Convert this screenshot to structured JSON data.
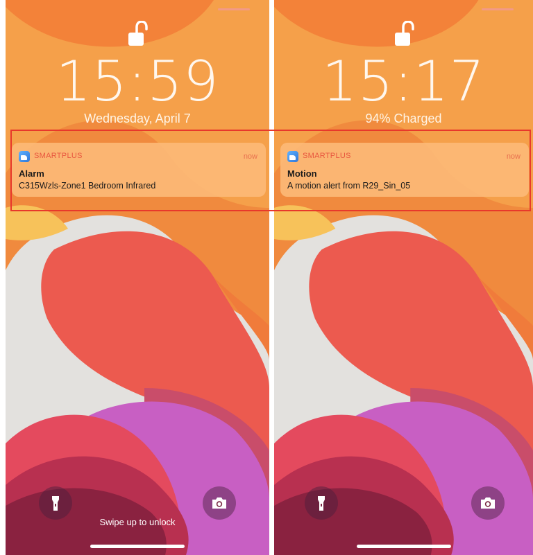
{
  "screens": [
    {
      "time": "15:59",
      "subline": "Wednesday, April 7",
      "notification": {
        "app_name": "SMARTPLUS",
        "timestamp": "now",
        "title": "Alarm",
        "body": "C315Wzls-Zone1 Bedroom Infrared"
      },
      "unlock_hint": "Swipe up to unlock"
    },
    {
      "time": "15:17",
      "subline": "94% Charged",
      "notification": {
        "app_name": "SMARTPLUS",
        "timestamp": "now",
        "title": "Motion",
        "body": "A motion alert from R29_Sin_05"
      }
    }
  ],
  "icons": {
    "lock": "unlocked-padlock-icon",
    "flashlight": "flashlight-icon",
    "camera": "camera-icon",
    "app": "smartplus-app-icon"
  },
  "colors": {
    "highlight": "#e8382b",
    "notification_bg": "#fcb876",
    "app_name": "#e8553e"
  }
}
